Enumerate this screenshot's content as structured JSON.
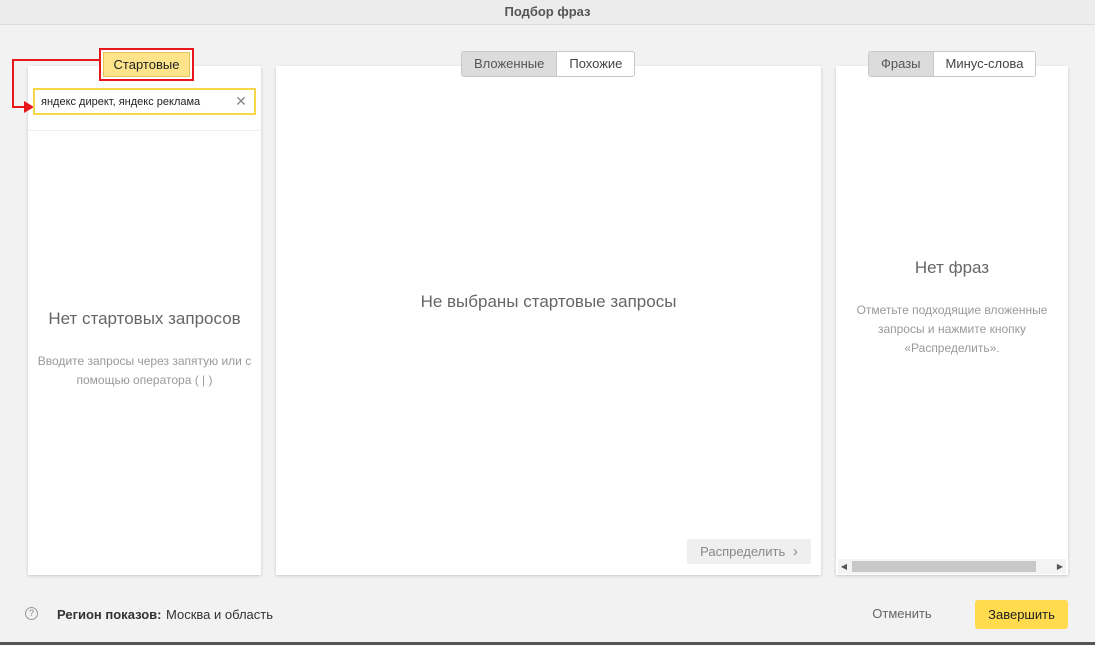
{
  "window": {
    "title": "Подбор фраз"
  },
  "start_panel": {
    "tab_label": "Стартовые",
    "search_value": "яндекс директ, яндекс реклама",
    "empty_title": "Нет стартовых запросов",
    "empty_text": "Вводите запросы через запятую или с помощью оператора ( | )"
  },
  "middle_panel": {
    "tabs": [
      {
        "label": "Вложенные",
        "active": true
      },
      {
        "label": "Похожие",
        "active": false
      }
    ],
    "empty_title": "Не выбраны стартовые запросы",
    "distribute_label": "Распределить",
    "distribute_chevron": "›"
  },
  "right_panel": {
    "tabs": [
      {
        "label": "Фразы",
        "active": true
      },
      {
        "label": "Минус-слова",
        "active": false
      }
    ],
    "empty_title": "Нет фраз",
    "empty_text": "Отметьте подходящие вложенные запросы и нажмите кнопку «Распределить»."
  },
  "footer": {
    "help_glyph": "?",
    "region_label": "Регион показов:",
    "region_value": "Москва и область",
    "cancel_label": "Отменить",
    "finish_label": "Завершить"
  },
  "colors": {
    "accent_yellow": "#ffdb4d",
    "highlight_red": "#e8151b"
  }
}
